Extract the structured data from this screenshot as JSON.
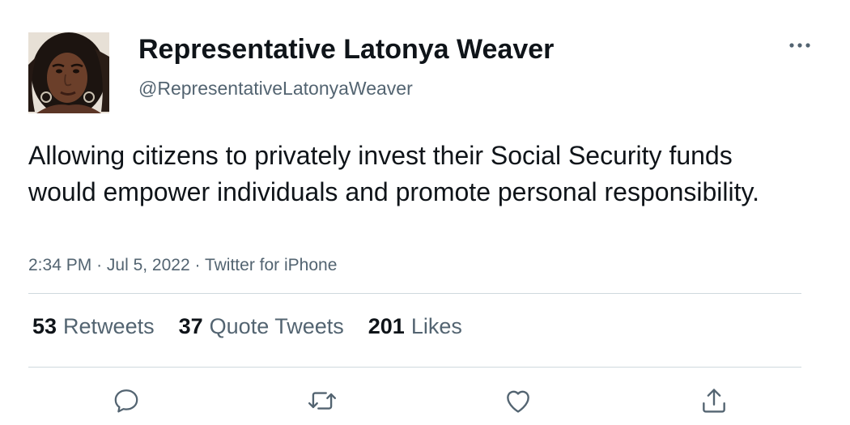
{
  "tweet": {
    "author": {
      "display_name": "Representative Latonya Weaver",
      "handle": "@RepresentativeLatonyaWeaver",
      "avatar_icon": "profile-photo"
    },
    "text": "Allowing citizens to privately invest their Social Security funds would empower individuals and promote personal responsibility.",
    "time": "2:34 PM",
    "date": "Jul 5, 2022",
    "source": "Twitter for iPhone",
    "separator": "·",
    "stats": {
      "retweets": {
        "count": "53",
        "label": "Retweets"
      },
      "quote_tweets": {
        "count": "37",
        "label": "Quote Tweets"
      },
      "likes": {
        "count": "201",
        "label": "Likes"
      }
    },
    "actions": [
      "reply-icon",
      "retweet-icon",
      "like-icon",
      "share-icon"
    ],
    "more_icon": "more-icon"
  },
  "colors": {
    "text_primary": "#0f1419",
    "text_secondary": "#536471",
    "divider": "#cfd9de",
    "background": "#ffffff"
  }
}
